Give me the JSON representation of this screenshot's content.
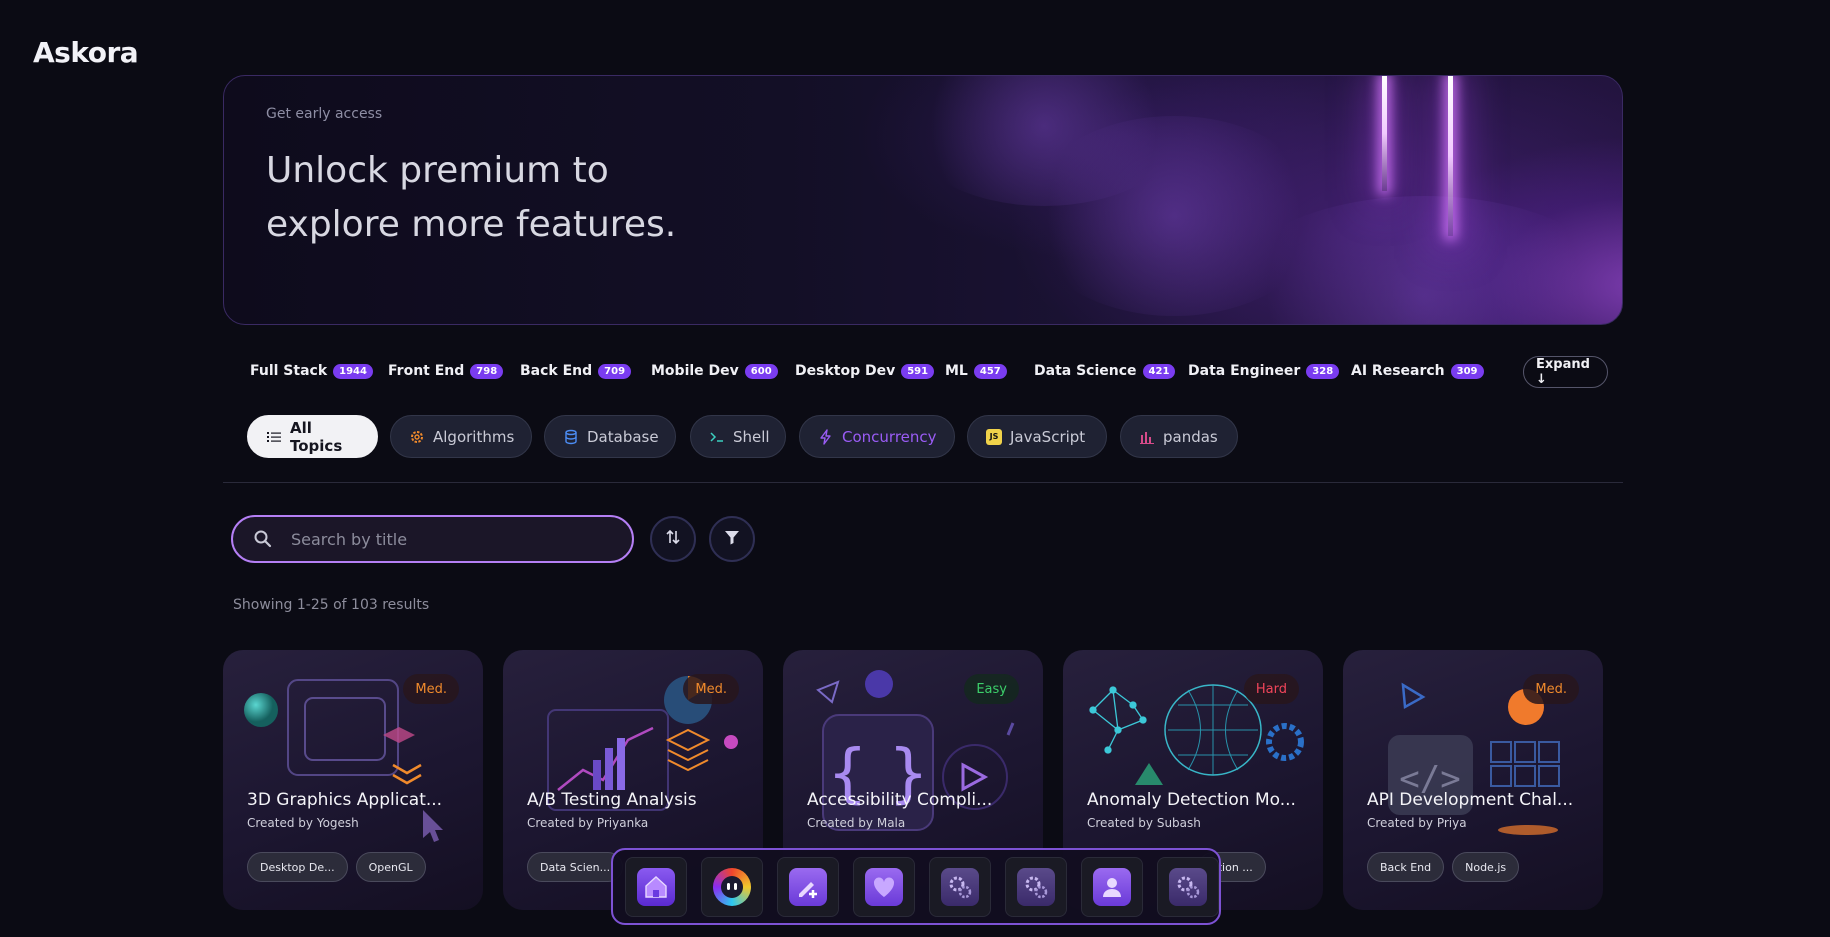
{
  "app": {
    "logo": "Askora"
  },
  "banner": {
    "eyebrow": "Get early access",
    "headline_line1": "Unlock premium to",
    "headline_line2": "explore more features."
  },
  "categories": [
    {
      "label": "Full Stack",
      "count": "1944"
    },
    {
      "label": "Front End",
      "count": "798"
    },
    {
      "label": "Back End",
      "count": "709"
    },
    {
      "label": "Mobile Dev",
      "count": "600"
    },
    {
      "label": "Desktop Dev",
      "count": "591"
    },
    {
      "label": "ML",
      "count": "457"
    },
    {
      "label": "Data Science",
      "count": "421"
    },
    {
      "label": "Data Engineer",
      "count": "328"
    },
    {
      "label": "AI Research",
      "count": "309"
    }
  ],
  "expand_label": "Expand ↓",
  "topics": [
    {
      "label": "All Topics",
      "icon": "list-icon"
    },
    {
      "label": "Algorithms",
      "icon": "gear-icon"
    },
    {
      "label": "Database",
      "icon": "database-icon"
    },
    {
      "label": "Shell",
      "icon": "terminal-icon"
    },
    {
      "label": "Concurrency",
      "icon": "lightning-icon"
    },
    {
      "label": "JavaScript",
      "icon": "js-icon"
    },
    {
      "label": "pandas",
      "icon": "bar-chart-icon"
    }
  ],
  "search": {
    "placeholder": "Search by title"
  },
  "results": {
    "text": "Showing 1-25 of 103 results"
  },
  "cards": [
    {
      "title": "3D Graphics Applicat...",
      "author": "Created by Yogesh",
      "difficulty": "Med.",
      "tags": [
        "Desktop De...",
        "OpenGL"
      ]
    },
    {
      "title": "A/B Testing Analysis",
      "author": "Created by Priyanka",
      "difficulty": "Med.",
      "tags": [
        "Data Scien..."
      ]
    },
    {
      "title": "Accessibility Compli...",
      "author": "Created by Mala",
      "difficulty": "Easy",
      "tags": []
    },
    {
      "title": "Anomaly Detection Mo...",
      "author": "Created by Subash",
      "difficulty": "Hard",
      "tags": [
        "ation ..."
      ]
    },
    {
      "title": "API Development Chal...",
      "author": "Created by Priya",
      "difficulty": "Med.",
      "tags": [
        "Back End",
        "Node.js"
      ]
    }
  ],
  "colors": {
    "accent": "#7a3cf0",
    "easy": "#3ccf6a",
    "medium": "#f08a2c",
    "hard": "#f0455a"
  },
  "dock": [
    {
      "icon": "home-icon"
    },
    {
      "icon": "chat-assistant-icon"
    },
    {
      "icon": "pencil-add-icon"
    },
    {
      "icon": "heart-icon"
    },
    {
      "icon": "settings-gears-icon"
    },
    {
      "icon": "settings-gears-icon"
    },
    {
      "icon": "profile-icon"
    },
    {
      "icon": "settings-gears-icon"
    }
  ]
}
